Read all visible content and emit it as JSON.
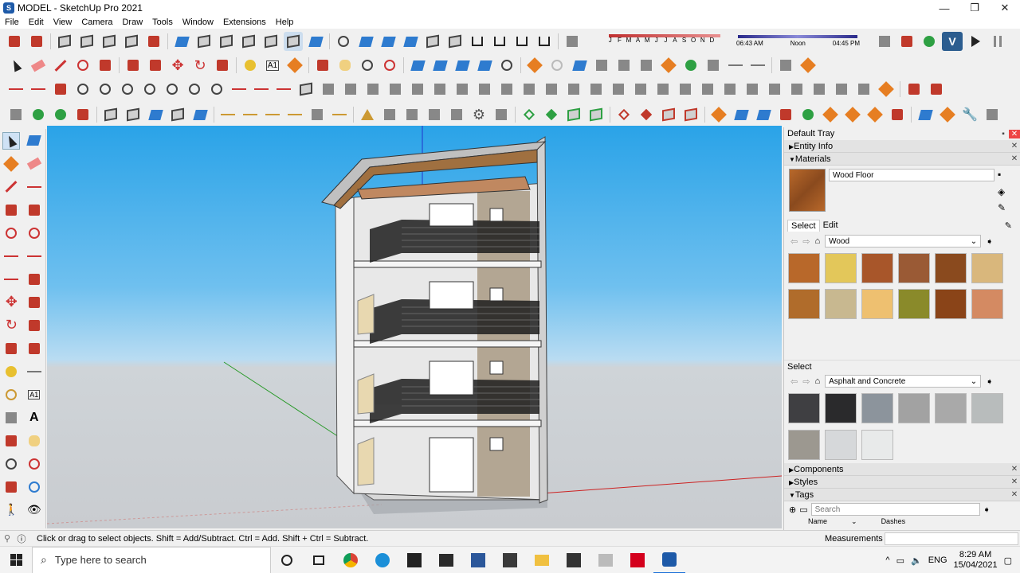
{
  "window": {
    "title": "MODEL - SketchUp Pro 2021",
    "minimize": "—",
    "maximize": "❐",
    "close": "✕"
  },
  "menu": [
    "File",
    "Edit",
    "View",
    "Camera",
    "Draw",
    "Tools",
    "Window",
    "Extensions",
    "Help"
  ],
  "shadow": {
    "months": [
      "J",
      "F",
      "M",
      "A",
      "M",
      "J",
      "J",
      "A",
      "S",
      "O",
      "N",
      "D"
    ],
    "time_start": "06:43 AM",
    "time_mid": "Noon",
    "time_end": "04:45 PM"
  },
  "tray": {
    "title": "Default Tray",
    "entity_info": "Entity Info",
    "materials": "Materials",
    "material_name": "Wood Floor",
    "tab_select": "Select",
    "tab_edit": "Edit",
    "library1": "Wood",
    "select2": "Select",
    "library2": "Asphalt and Concrete",
    "components": "Components",
    "styles": "Styles",
    "tags": "Tags",
    "tags_search_placeholder": "Search",
    "col_name": "Name",
    "col_dashes": "Dashes"
  },
  "wood_swatches": [
    "#b8682a",
    "#e3c75a",
    "#a8562a",
    "#9a5a35",
    "#8a4a1e",
    "#d9b77c",
    "#b06c2b",
    "#c8b890",
    "#eec070",
    "#8a8a2a",
    "#8a4418",
    "#d48a62"
  ],
  "concrete_swatches": [
    "#3f3f42",
    "#2a2a2c",
    "#8c949c",
    "#a2a2a2",
    "#a9a9a9",
    "#b8bcbc",
    "#9c9890",
    "#d6d8da",
    "#e8eaea"
  ],
  "status": {
    "message": "Click or drag to select objects. Shift = Add/Subtract. Ctrl = Add. Shift + Ctrl = Subtract.",
    "measurements": "Measurements"
  },
  "taskbar": {
    "search_placeholder": "Type here to search",
    "time": "8:29 AM",
    "date": "15/04/2021",
    "lang": "ENG"
  }
}
